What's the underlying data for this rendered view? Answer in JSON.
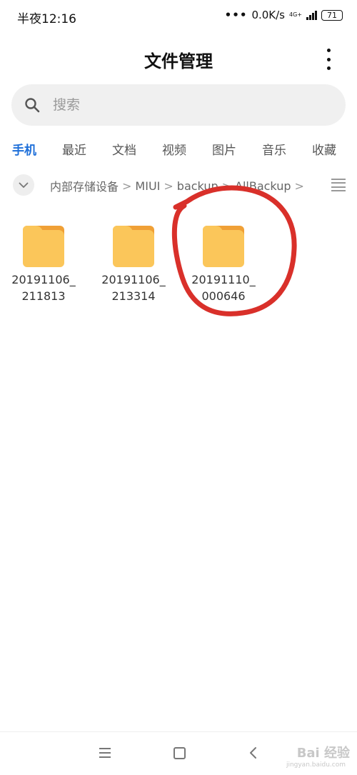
{
  "status_bar": {
    "time": "半夜12:16",
    "dots": "•••",
    "net_speed": "0.0K/s",
    "net_type": "4G+",
    "battery": "71"
  },
  "header": {
    "title": "文件管理"
  },
  "search": {
    "placeholder": "搜索"
  },
  "tabs": [
    {
      "label": "手机",
      "active": true
    },
    {
      "label": "最近",
      "active": false
    },
    {
      "label": "文档",
      "active": false
    },
    {
      "label": "视频",
      "active": false
    },
    {
      "label": "图片",
      "active": false
    },
    {
      "label": "音乐",
      "active": false
    },
    {
      "label": "收藏",
      "active": false
    }
  ],
  "breadcrumb": {
    "items": [
      "内部存储设备",
      "MIUI",
      "backup",
      "AllBackup"
    ],
    "separator": ">"
  },
  "folders": [
    {
      "name_line1": "20191106_",
      "name_line2": "211813"
    },
    {
      "name_line1": "20191106_",
      "name_line2": "213314"
    },
    {
      "name_line1": "20191110_",
      "name_line2": "000646"
    }
  ],
  "colors": {
    "accent": "#1e6fd9",
    "folder_body": "#fbc65a",
    "folder_tab": "#f0a036",
    "annotation": "#d9302a"
  },
  "watermark": {
    "text": "Bai 经验",
    "url": "jingyan.baidu.com"
  }
}
